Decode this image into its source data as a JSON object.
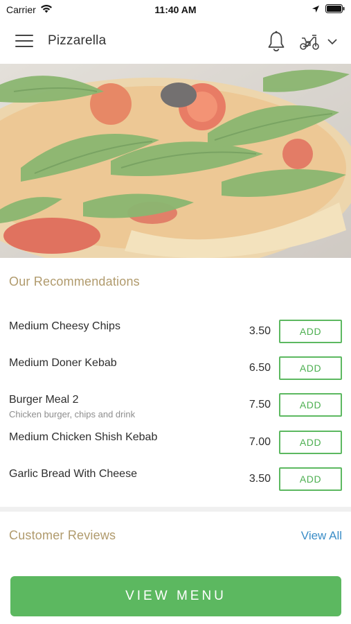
{
  "status_bar": {
    "carrier": "Carrier",
    "time": "11:40 AM"
  },
  "header": {
    "title": "Pizzarella",
    "icons": [
      "hamburger-menu-icon",
      "bell-icon",
      "scooter-icon",
      "chevron-down-icon"
    ]
  },
  "hero": {
    "icon": "pizza-hero-image"
  },
  "recommendations": {
    "title": "Our Recommendations",
    "items": [
      {
        "name": "Medium Cheesy Chips",
        "price": "3.50",
        "add_label": "ADD",
        "description": ""
      },
      {
        "name": "Medium Doner Kebab",
        "price": "6.50",
        "add_label": "ADD",
        "description": ""
      },
      {
        "name": "Burger Meal 2",
        "price": "7.50",
        "add_label": "ADD",
        "description": "Chicken burger, chips and drink"
      },
      {
        "name": "Medium Chicken Shish Kebab",
        "price": "7.00",
        "add_label": "ADD",
        "description": ""
      },
      {
        "name": "Garlic Bread With Cheese",
        "price": "3.50",
        "add_label": "ADD",
        "description": ""
      }
    ]
  },
  "reviews": {
    "title": "Customer Reviews",
    "view_all_label": "View All"
  },
  "footer": {
    "view_menu_label": "VIEW MENU"
  },
  "colors": {
    "accent_green": "#5cb860",
    "section_title_gold": "#b09a6c",
    "link_blue": "#3a8dc7"
  }
}
